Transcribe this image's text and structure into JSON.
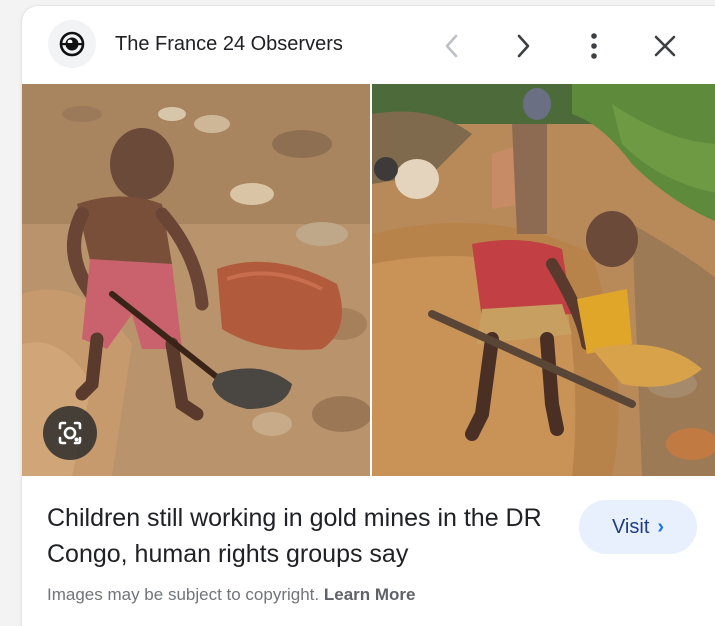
{
  "header": {
    "source_name": "The France 24 Observers",
    "icons": {
      "favicon": "france24-observers-eye-icon",
      "prev": "chevron-left-icon",
      "next": "chevron-right-icon",
      "more": "more-vertical-icon",
      "close": "close-icon"
    }
  },
  "images": {
    "lens_icon": "google-lens-icon"
  },
  "result": {
    "title": "Children still working in gold mines in the DR Congo, human rights groups say",
    "visit_label": "Visit",
    "visit_chevron": "›"
  },
  "footer": {
    "copyright_text": "Images may be subject to copyright.",
    "learn_more": "Learn More"
  },
  "colors": {
    "accent": "#1a73e8",
    "visit_bg": "#e8f0fe",
    "text_primary": "#202124",
    "text_secondary": "#70757a"
  }
}
